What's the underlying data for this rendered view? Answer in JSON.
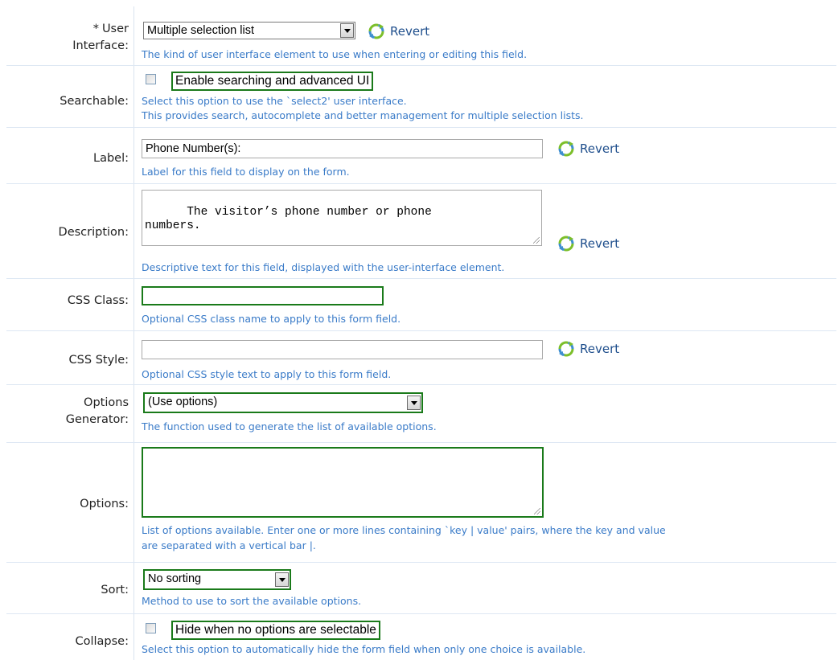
{
  "revert_label": "Revert",
  "fields": {
    "user_interface": {
      "required_marker": "*",
      "label_line1": "User",
      "label_line2": "Interface:",
      "value": "Multiple selection list",
      "help": "The kind of user interface element to use when entering or editing this field."
    },
    "searchable": {
      "label": "Searchable:",
      "checkbox_label": "Enable searching and advanced UI",
      "checked": false,
      "help_line1": "Select this option to use the `select2' user interface.",
      "help_line2": "This provides search, autocomplete and better management for multiple selection lists."
    },
    "label": {
      "label": "Label:",
      "value": "Phone Number(s):",
      "help": "Label for this field to display on the form."
    },
    "description": {
      "label": "Description:",
      "value": "The visitor’s phone number or phone\nnumbers.",
      "help": "Descriptive text for this field, displayed with the user-interface element."
    },
    "css_class": {
      "label": "CSS Class:",
      "value": "",
      "help": "Optional CSS class name to apply to this form field."
    },
    "css_style": {
      "label": "CSS Style:",
      "value": "",
      "help": "Optional CSS style text to apply to this form field."
    },
    "options_generator": {
      "label_line1": "Options",
      "label_line2": "Generator:",
      "value": "(Use options)",
      "help": "The function used to generate the list of available options."
    },
    "options": {
      "label": "Options:",
      "value": "",
      "help_line1": "List of options available. Enter one or more lines containing `key | value' pairs, where the key and value",
      "help_line2": "are separated with a vertical bar |."
    },
    "sort": {
      "label": "Sort:",
      "value": "No sorting",
      "help": "Method to use to sort the available options."
    },
    "collapse": {
      "label": "Collapse:",
      "checkbox_label": "Hide when no options are selectable",
      "checked": false,
      "help": "Select this option to automatically hide the form field when only one choice is available."
    }
  },
  "colors": {
    "highlight": "#1a7a1a",
    "help_text": "#3a7bc8",
    "revert_text": "#1e4e8c",
    "row_border": "#dde7f3"
  },
  "icons": {
    "revert": "revert-arrows-icon",
    "dropdown": "chevron-down-icon"
  }
}
